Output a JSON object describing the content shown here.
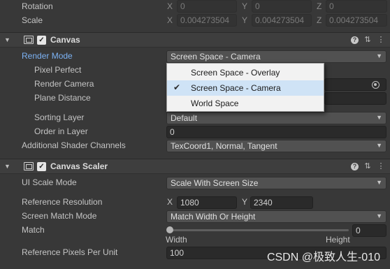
{
  "transform": {
    "rotation_label": "Rotation",
    "scale_label": "Scale",
    "rotation": {
      "x_axis": "X",
      "x": "0",
      "y_axis": "Y",
      "y": "0",
      "z_axis": "Z",
      "z": "0"
    },
    "scale": {
      "x_axis": "X",
      "x": "0.004273504",
      "y_axis": "Y",
      "y": "0.004273504",
      "z_axis": "Z",
      "z": "0.004273504"
    }
  },
  "canvas": {
    "title": "Canvas",
    "render_mode_label": "Render Mode",
    "render_mode_value": "Screen Space - Camera",
    "pixel_perfect_label": "Pixel Perfect",
    "render_camera_label": "Render Camera",
    "plane_distance_label": "Plane Distance",
    "sorting_layer_label": "Sorting Layer",
    "sorting_layer_value": "Default",
    "order_in_layer_label": "Order in Layer",
    "order_in_layer_value": "0",
    "shader_channels_label": "Additional Shader Channels",
    "shader_channels_value": "TexCoord1, Normal, Tangent",
    "dropdown_options": [
      {
        "label": "Screen Space - Overlay",
        "selected": false
      },
      {
        "label": "Screen Space - Camera",
        "selected": true
      },
      {
        "label": "World Space",
        "selected": false
      }
    ]
  },
  "canvas_scaler": {
    "title": "Canvas Scaler",
    "ui_scale_mode_label": "UI Scale Mode",
    "ui_scale_mode_value": "Scale With Screen Size",
    "ref_resolution_label": "Reference Resolution",
    "ref_x_axis": "X",
    "ref_x": "1080",
    "ref_y_axis": "Y",
    "ref_y": "2340",
    "screen_match_mode_label": "Screen Match Mode",
    "screen_match_mode_value": "Match Width Or Height",
    "match_label": "Match",
    "match_value": "0",
    "match_level": 0,
    "width_label": "Width",
    "height_label": "Height",
    "ref_ppu_label": "Reference Pixels Per Unit",
    "ref_ppu_value": "100"
  },
  "icons": {
    "help": "?",
    "settings": "⇅",
    "menu": "⋮",
    "check": "✓",
    "tick": "✔"
  },
  "watermark": "CSDN @极致人生-010",
  "colors": {
    "label_highlight": "#7cb2f4",
    "panel_bg": "#383838",
    "popup_bg": "#f2f2f2",
    "popup_selected": "#cfe3f6"
  }
}
